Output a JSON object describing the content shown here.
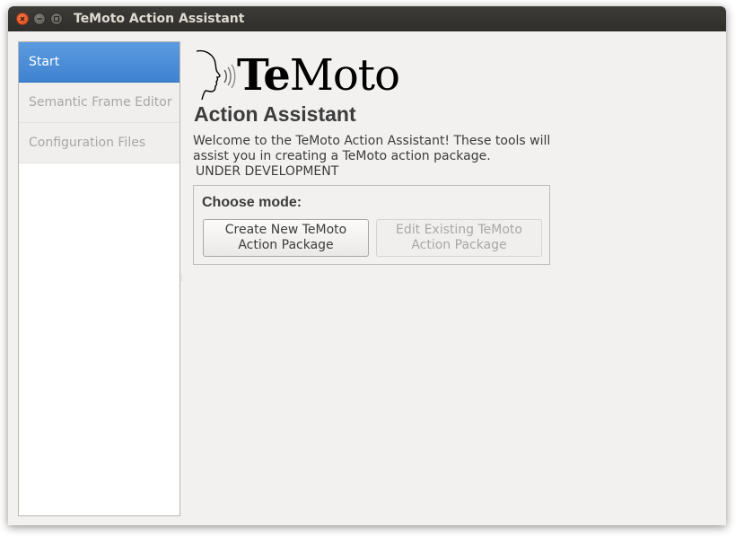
{
  "window": {
    "title": "TeMoto Action Assistant"
  },
  "sidebar": {
    "items": [
      {
        "label": "Start",
        "active": true
      },
      {
        "label": "Semantic Frame Editor",
        "active": false
      },
      {
        "label": "Configuration Files",
        "active": false
      }
    ]
  },
  "logo": {
    "text_bold": "Te",
    "text_regular": "Moto",
    "icon": "head-speaking-icon"
  },
  "main": {
    "title": "Action Assistant",
    "welcome_text": "Welcome to the TeMoto Action Assistant! These tools will assist you in creating a TeMoto action package.",
    "dev_note": "UNDER DEVELOPMENT",
    "mode_box": {
      "label": "Choose mode:",
      "create_button": {
        "line1": "Create New TeMoto",
        "line2": "Action Package",
        "enabled": true
      },
      "edit_button": {
        "line1": "Edit Existing TeMoto",
        "line2": "Action Package",
        "enabled": false
      }
    }
  },
  "colors": {
    "titlebar": "#3c3b37",
    "selection": "#4a8ed8",
    "close_button": "#e95420",
    "window_bg": "#f2f1f0"
  }
}
